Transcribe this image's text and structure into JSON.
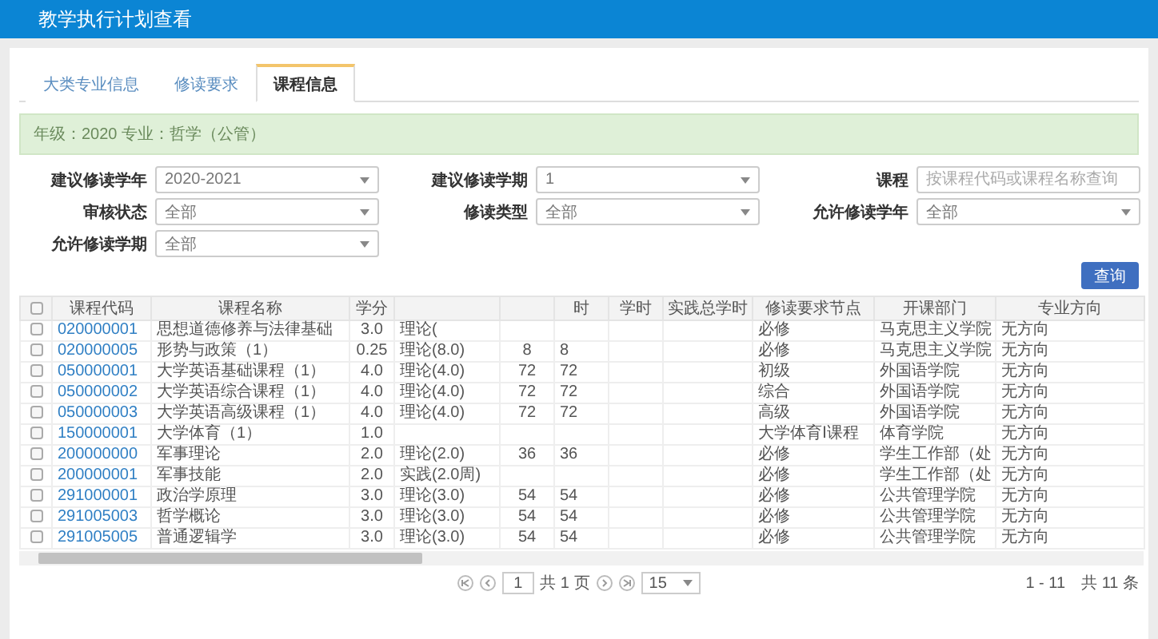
{
  "window": {
    "title": "教学执行计划查看"
  },
  "tabs": [
    {
      "label": "大类专业信息",
      "selected": false
    },
    {
      "label": "修读要求",
      "selected": false
    },
    {
      "label": "课程信息",
      "selected": true
    }
  ],
  "info": "年级：2020 专业：哲学（公管）",
  "form": [
    {
      "label": "建议修读学年",
      "kind": "select",
      "value": "2020-2021"
    },
    {
      "label": "建议修读学期",
      "kind": "select",
      "value": "1"
    },
    {
      "label": "课程",
      "kind": "input",
      "placeholder": "按课程代码或课程名称查询"
    },
    {
      "label": "审核状态",
      "kind": "select",
      "value": "全部"
    },
    {
      "label": "修读类型",
      "kind": "select",
      "value": "全部"
    },
    {
      "label": "允许修读学年",
      "kind": "select",
      "value": "全部"
    },
    {
      "label": "允许修读学期",
      "kind": "select",
      "value": "全部"
    }
  ],
  "query_button": "查询",
  "table": {
    "all_checked": false,
    "columns": [
      "课程代码",
      "课程名称",
      "学分",
      "",
      "",
      "时",
      "学时",
      "实践总学时",
      "修读要求节点",
      "开课部门",
      "专业方向"
    ],
    "rows": [
      {
        "checked": false,
        "cells": [
          "020000001",
          "思想道德修养与法律基础",
          "3.0",
          "理论(",
          "",
          "",
          "",
          "",
          "必修",
          "马克思主义学院",
          "无方向"
        ]
      },
      {
        "checked": false,
        "cells": [
          "020000005",
          "形势与政策（1）",
          "0.25",
          "理论(8.0)",
          "8",
          "8",
          "",
          "",
          "必修",
          "马克思主义学院",
          "无方向"
        ]
      },
      {
        "checked": false,
        "cells": [
          "050000001",
          "大学英语基础课程（1）",
          "4.0",
          "理论(4.0)",
          "72",
          "72",
          "",
          "",
          "初级",
          "外国语学院",
          "无方向"
        ]
      },
      {
        "checked": false,
        "cells": [
          "050000002",
          "大学英语综合课程（1）",
          "4.0",
          "理论(4.0)",
          "72",
          "72",
          "",
          "",
          "综合",
          "外国语学院",
          "无方向"
        ]
      },
      {
        "checked": false,
        "cells": [
          "050000003",
          "大学英语高级课程（1）",
          "4.0",
          "理论(4.0)",
          "72",
          "72",
          "",
          "",
          "高级",
          "外国语学院",
          "无方向"
        ]
      },
      {
        "checked": false,
        "cells": [
          "150000001",
          "大学体育（1）",
          "1.0",
          "",
          "",
          "",
          "",
          "",
          "大学体育Ⅰ课程",
          "体育学院",
          "无方向"
        ]
      },
      {
        "checked": false,
        "cells": [
          "200000000",
          "军事理论",
          "2.0",
          "理论(2.0)",
          "36",
          "36",
          "",
          "",
          "必修",
          "学生工作部（处",
          "无方向"
        ]
      },
      {
        "checked": false,
        "cells": [
          "200000001",
          "军事技能",
          "2.0",
          "实践(2.0周)",
          "",
          "",
          "",
          "",
          "必修",
          "学生工作部（处",
          "无方向"
        ]
      },
      {
        "checked": false,
        "cells": [
          "291000001",
          "政治学原理",
          "3.0",
          "理论(3.0)",
          "54",
          "54",
          "",
          "",
          "必修",
          "公共管理学院",
          "无方向"
        ]
      },
      {
        "checked": false,
        "cells": [
          "291005003",
          "哲学概论",
          "3.0",
          "理论(3.0)",
          "54",
          "54",
          "",
          "",
          "必修",
          "公共管理学院",
          "无方向"
        ]
      },
      {
        "checked": false,
        "cells": [
          "291005005",
          "普通逻辑学",
          "3.0",
          "理论(3.0)",
          "54",
          "54",
          "",
          "",
          "必修",
          "公共管理学院",
          "无方向"
        ]
      }
    ]
  },
  "pagination": {
    "page": "1",
    "total_pages": "共 1 页",
    "page_size": "15",
    "summary": "1 - 11　共 11 条"
  }
}
